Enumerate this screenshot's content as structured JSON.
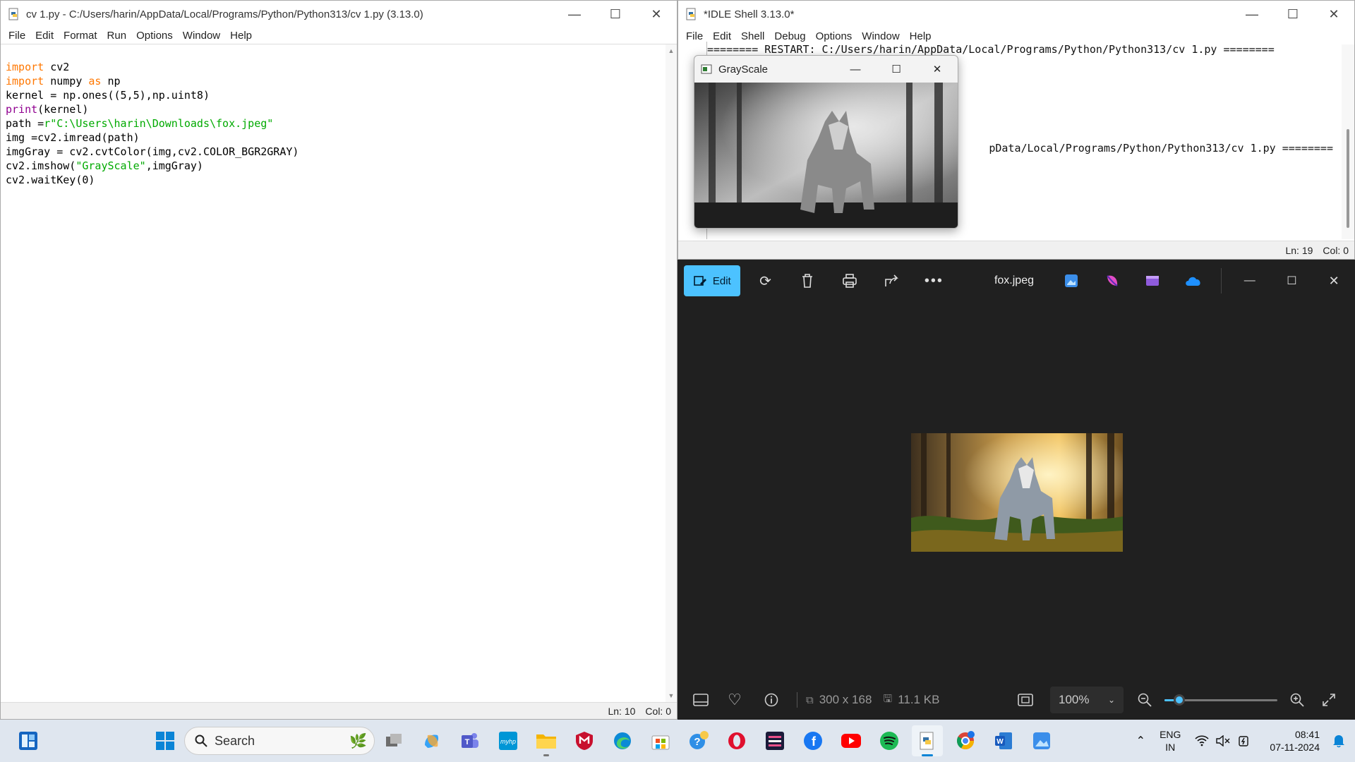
{
  "editor": {
    "title": "cv 1.py - C:/Users/harin/AppData/Local/Programs/Python/Python313/cv 1.py (3.13.0)",
    "menu": [
      "File",
      "Edit",
      "Format",
      "Run",
      "Options",
      "Window",
      "Help"
    ],
    "code": [
      {
        "kw": "import",
        "rest": " cv2"
      },
      {
        "kw": "import",
        "rest": " numpy ",
        "kw2": "as",
        "rest2": " np"
      },
      {
        "text": "kernel = np.ones((5,5),np.uint8)"
      },
      {
        "bi": "print",
        "text": "(kernel)"
      },
      {
        "pre": "path =",
        "str": "r\"C:\\Users\\harin\\Downloads\\fox.jpeg\""
      },
      {
        "text": "img =cv2.imread(path)"
      },
      {
        "text": "imgGray = cv2.cvtColor(img,cv2.COLOR_BGR2GRAY)"
      },
      {
        "pre": "cv2.imshow(",
        "str": "\"GrayScale\"",
        "post": ",imgGray)"
      },
      {
        "text": "cv2.waitKey(0)"
      }
    ],
    "status_ln": "Ln: 10",
    "status_col": "Col: 0"
  },
  "shell": {
    "title": "*IDLE Shell 3.13.0*",
    "menu": [
      "File",
      "Edit",
      "Shell",
      "Debug",
      "Options",
      "Window",
      "Help"
    ],
    "line1": "======== RESTART: C:/Users/harin/AppData/Local/Programs/Python/Python313/cv 1.py ========",
    "line2": "pData/Local/Programs/Python/Python313/cv 1.py ========",
    "status_ln": "Ln: 19",
    "status_col": "Col: 0"
  },
  "grayscale_window": {
    "title": "GrayScale"
  },
  "photos": {
    "edit_label": "Edit",
    "filename": "fox.jpeg",
    "dimensions": "300 x 168",
    "filesize": "11.1 KB",
    "zoom": "100%",
    "zoom_level_fraction": 0.13
  },
  "taskbar": {
    "search_placeholder": "Search",
    "lang_top": "ENG",
    "lang_bottom": "IN",
    "time": "08:41",
    "date": "07-11-2024"
  }
}
